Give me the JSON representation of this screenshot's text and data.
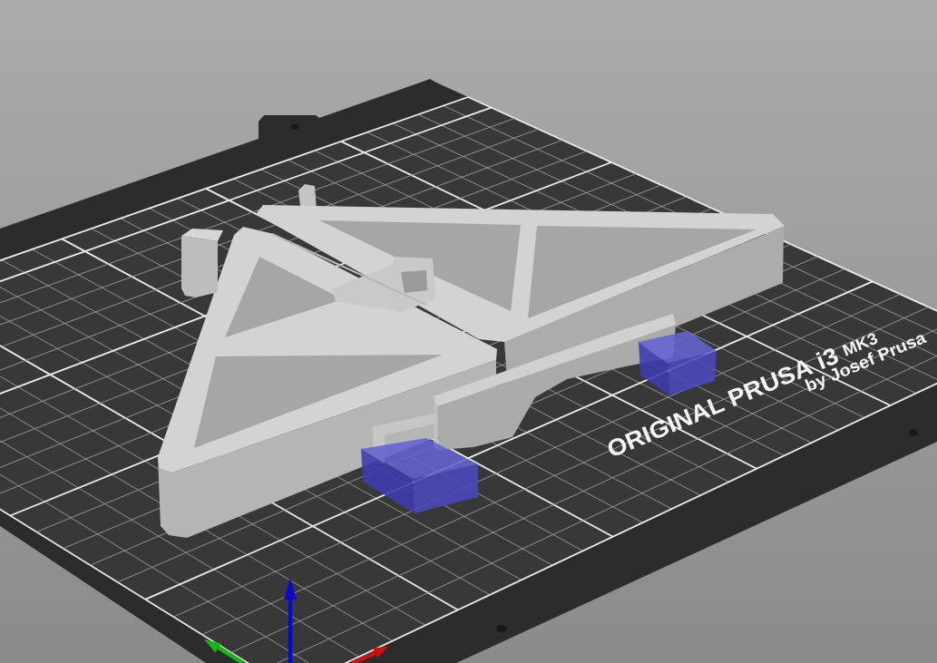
{
  "viewport": {
    "bed_label": {
      "title": [
        "ORIGINAL",
        "PRUSA",
        "i3"
      ],
      "model": "MK3",
      "maker": "by Josef Prusa"
    }
  }
}
